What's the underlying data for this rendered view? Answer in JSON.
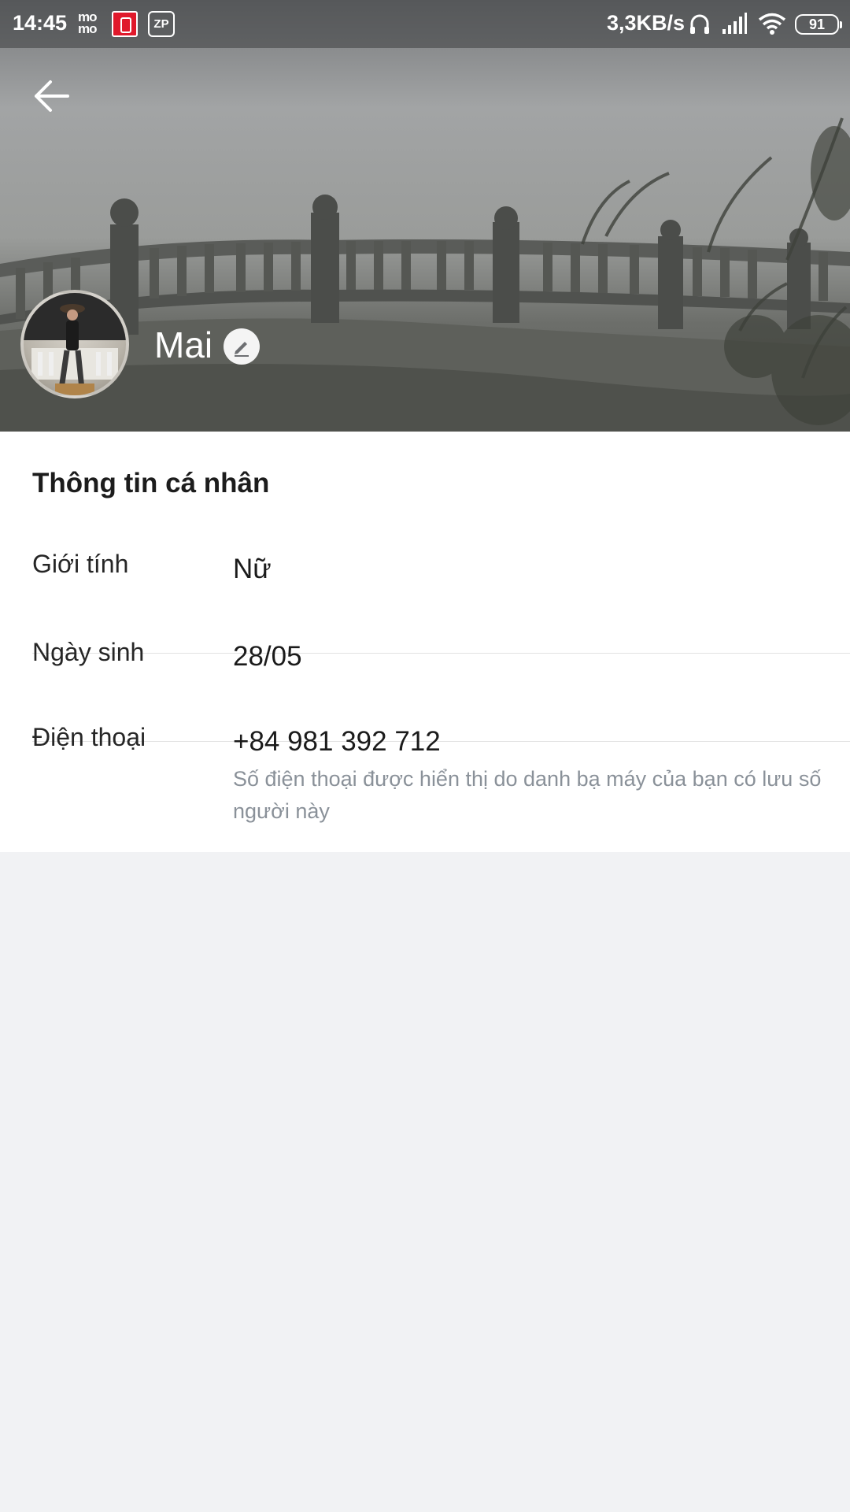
{
  "status_bar": {
    "time": "14:45",
    "momo_label": "mo\nmo",
    "zp_label": "ZP",
    "network_speed": "3,3KB/s",
    "battery": "91"
  },
  "header": {
    "back_icon": "arrow-left-icon",
    "name": "Mai",
    "edit_icon": "pencil-icon"
  },
  "profile": {
    "section_title": "Thông tin cá nhân",
    "fields": [
      {
        "label": "Giới tính",
        "value": "Nữ"
      },
      {
        "label": "Ngày sinh",
        "value": "28/05"
      },
      {
        "label": "Điện thoại",
        "value": "+84 981 392 712",
        "note": "Số điện thoại được hiển thị do danh bạ máy của bạn có lưu số người này"
      }
    ]
  },
  "colors": {
    "background": "#f1f2f4",
    "card": "#ffffff",
    "note_text": "#8a9199"
  }
}
